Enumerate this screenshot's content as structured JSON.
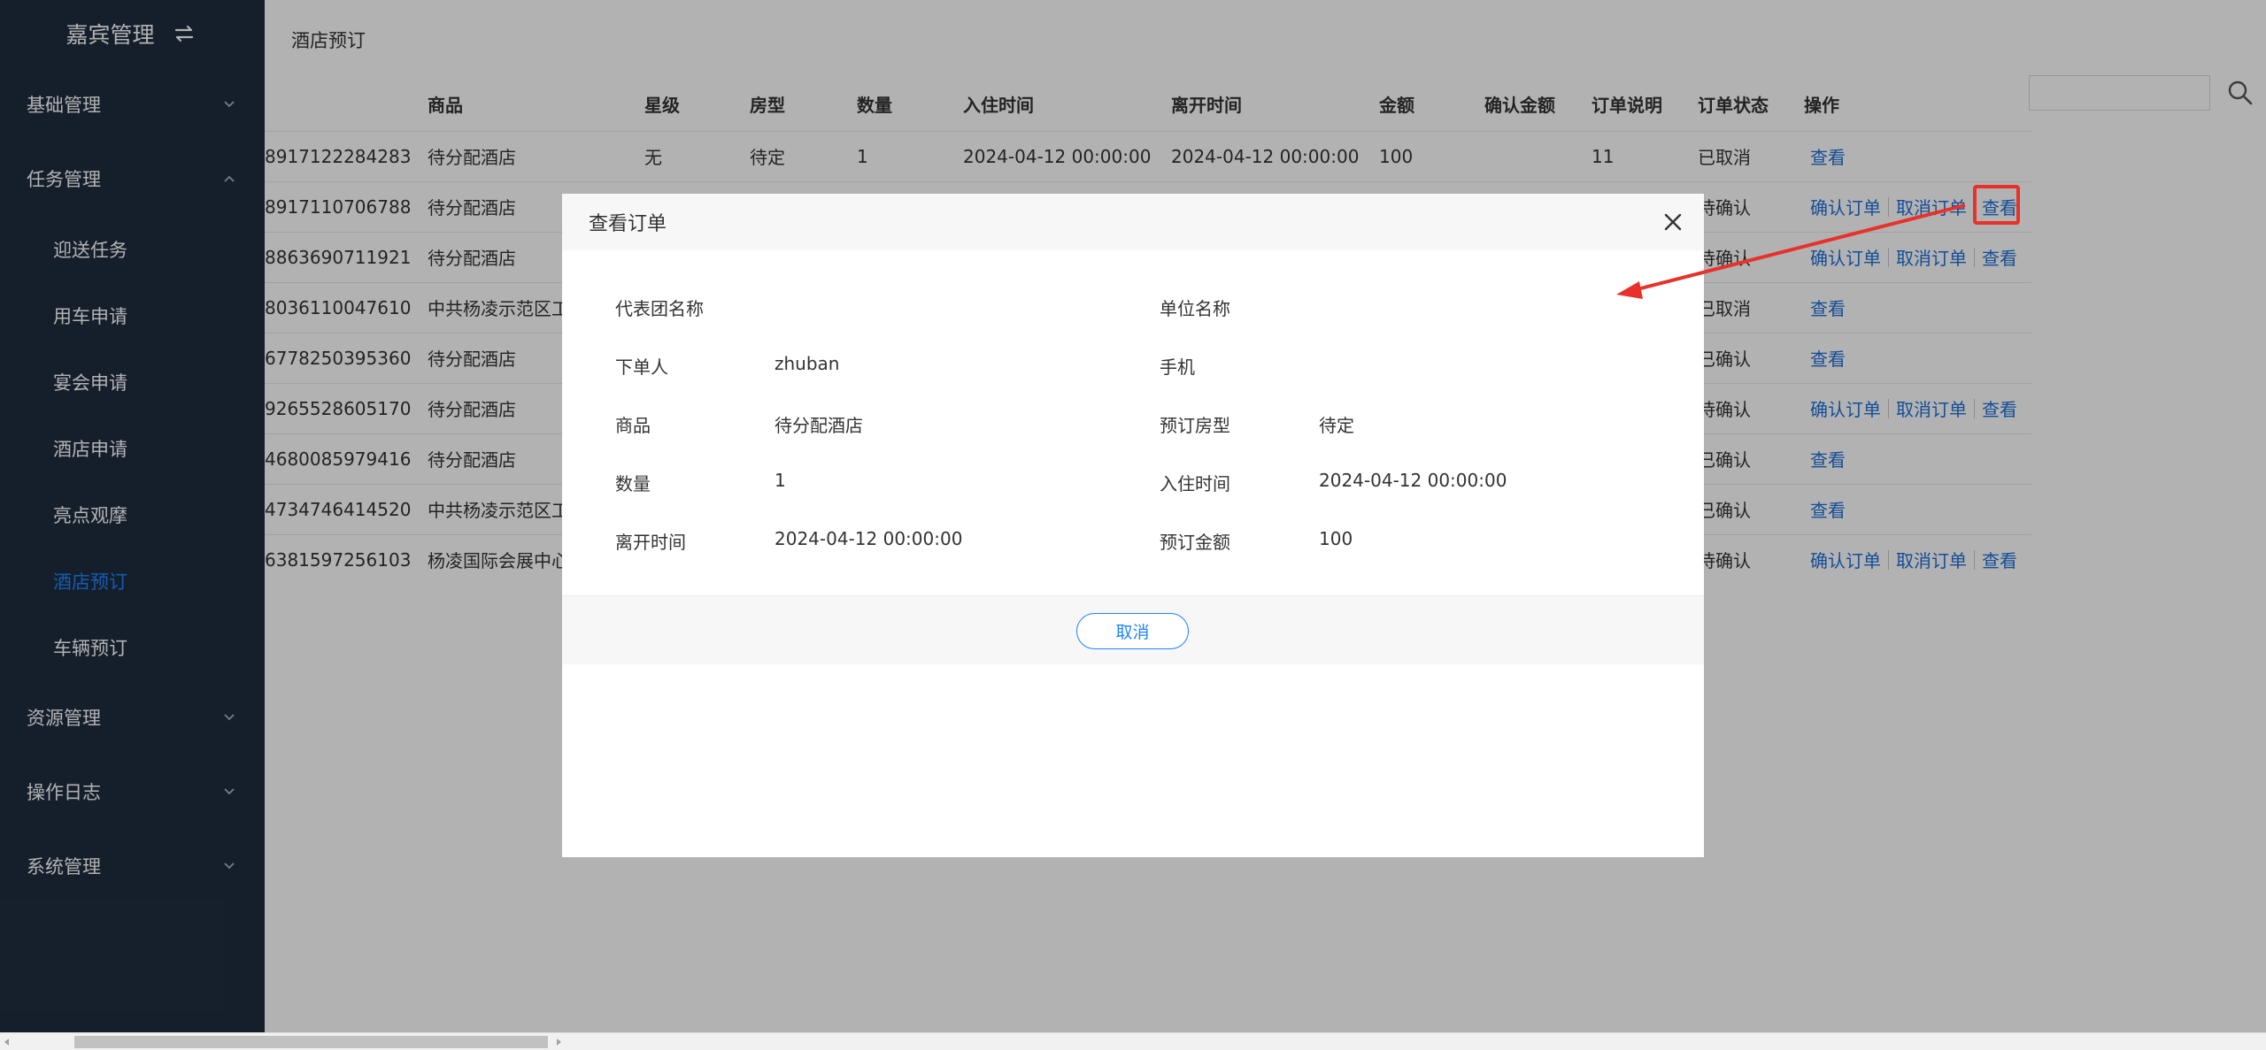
{
  "sidebar": {
    "brand_title": "嘉宾管理",
    "groups": [
      {
        "label": "基础管理"
      },
      {
        "label": "任务管理"
      },
      {
        "label": "资源管理"
      },
      {
        "label": "操作日志"
      },
      {
        "label": "系统管理"
      }
    ],
    "sub_items": [
      {
        "label": "迎送任务"
      },
      {
        "label": "用车申请"
      },
      {
        "label": "宴会申请"
      },
      {
        "label": "酒店申请"
      },
      {
        "label": "亮点观摩"
      },
      {
        "label": "酒店预订"
      },
      {
        "label": "车辆预订"
      }
    ]
  },
  "main": {
    "breadcrumb": "酒店预订",
    "search_placeholder": ""
  },
  "table": {
    "headers": [
      "",
      "商品",
      "星级",
      "房型",
      "数量",
      "入住时间",
      "离开时间",
      "金额",
      "确认金额",
      "订单说明",
      "订单状态",
      "操作"
    ],
    "rows": [
      {
        "id": "8917122284283",
        "product": "待分配酒店",
        "star": "无",
        "room": "待定",
        "qty": "1",
        "checkin": "2024-04-12 00:00:00",
        "checkout": "2024-04-12 00:00:00",
        "amount": "100",
        "confirm_amount": "",
        "note": "11",
        "status": "已取消",
        "ops": [
          "查看"
        ]
      },
      {
        "id": "8917110706788",
        "product": "待分配酒店",
        "star": "",
        "room": "",
        "qty": "",
        "checkin": "",
        "checkout": "",
        "amount": "",
        "confirm_amount": "",
        "note": "",
        "status": "待确认",
        "ops": [
          "确认订单",
          "取消订单",
          "查看"
        ]
      },
      {
        "id": "8863690711921",
        "product": "待分配酒店",
        "star": "",
        "room": "",
        "qty": "",
        "checkin": "",
        "checkout": "",
        "amount": "",
        "confirm_amount": "",
        "note": "",
        "status": "待确认",
        "ops": [
          "确认订单",
          "取消订单",
          "查看"
        ]
      },
      {
        "id": "8036110047610",
        "product": "中共杨凌示范区工",
        "star": "",
        "room": "",
        "qty": "",
        "checkin": "",
        "checkout": "",
        "amount": "",
        "confirm_amount": "",
        "note": "",
        "status": "已取消",
        "ops": [
          "查看"
        ]
      },
      {
        "id": "6778250395360",
        "product": "待分配酒店",
        "star": "",
        "room": "",
        "qty": "",
        "checkin": "",
        "checkout": "",
        "amount": "",
        "confirm_amount": "",
        "note": "",
        "status": "已确认",
        "ops": [
          "查看"
        ]
      },
      {
        "id": "9265528605170",
        "product": "待分配酒店",
        "star": "",
        "room": "",
        "qty": "",
        "checkin": "",
        "checkout": "",
        "amount": "",
        "confirm_amount": "",
        "note": "",
        "status": "待确认",
        "ops": [
          "确认订单",
          "取消订单",
          "查看"
        ]
      },
      {
        "id": "4680085979416",
        "product": "待分配酒店",
        "star": "",
        "room": "",
        "qty": "",
        "checkin": "",
        "checkout": "",
        "amount": "",
        "confirm_amount": "",
        "note": "",
        "status": "已确认",
        "ops": [
          "查看"
        ]
      },
      {
        "id": "4734746414520",
        "product": "中共杨凌示范区工",
        "star": "",
        "room": "",
        "qty": "",
        "checkin": "",
        "checkout": "",
        "amount": "",
        "confirm_amount": "",
        "note": "",
        "status": "已确认",
        "ops": [
          "查看"
        ]
      },
      {
        "id": "6381597256103",
        "product": "杨凌国际会展中心",
        "star": "",
        "room": "",
        "qty": "",
        "checkin": "",
        "checkout": "",
        "amount": "",
        "confirm_amount": "",
        "note": "",
        "status": "待确认",
        "ops": [
          "确认订单",
          "取消订单",
          "查看"
        ]
      }
    ]
  },
  "modal": {
    "title": "查看订单",
    "fields": [
      {
        "label": "代表团名称",
        "value": ""
      },
      {
        "label": "单位名称",
        "value": ""
      },
      {
        "label": "下单人",
        "value": "zhuban"
      },
      {
        "label": "手机",
        "value": ""
      },
      {
        "label": "商品",
        "value": "待分配酒店"
      },
      {
        "label": "预订房型",
        "value": "待定"
      },
      {
        "label": "数量",
        "value": "1"
      },
      {
        "label": "入住时间",
        "value": "2024-04-12 00:00:00"
      },
      {
        "label": "离开时间",
        "value": "2024-04-12 00:00:00"
      },
      {
        "label": "预订金额",
        "value": "100"
      }
    ],
    "cancel_label": "取消"
  },
  "colors": {
    "sidebar_bg": "#1f2d3f",
    "accent": "#1e84ff",
    "link": "#1e6fd9",
    "annotation": "#e8312a"
  },
  "icons": {
    "brand_toggle": "swap-icon",
    "group_arrow": "chevron-icon",
    "search": "search-icon",
    "close": "close-icon"
  }
}
